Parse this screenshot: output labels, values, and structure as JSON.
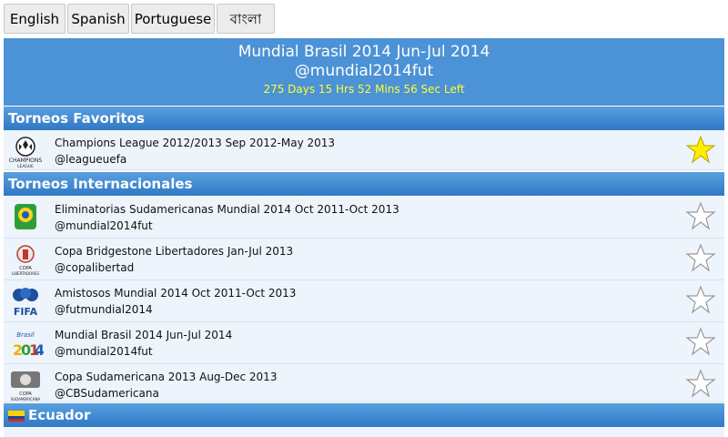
{
  "languages": [
    "English",
    "Spanish",
    "Portuguese",
    "বাংলা"
  ],
  "header": {
    "title": "Mundial Brasil 2014 Jun-Jul 2014",
    "handle": "@mundial2014fut",
    "countdown": "275 Days 15 Hrs 52 Mins 56 Sec Left"
  },
  "sections": {
    "favoritos": "Torneos Favoritos",
    "internacionales": "Torneos Internacionales",
    "ecuador": "Ecuador"
  },
  "favoritos": [
    {
      "name": "Champions League 2012/2013 Sep 2012-May 2013",
      "handle": "@leagueuefa",
      "logo": "champions-league-logo",
      "starred": true
    }
  ],
  "internacionales": [
    {
      "name": "Eliminatorias Sudamericanas Mundial 2014 Oct 2011-Oct 2013",
      "handle": "@mundial2014fut",
      "logo": "eliminatorias-logo",
      "starred": false
    },
    {
      "name": "Copa Bridgestone Libertadores Jan-Jul 2013",
      "handle": "@copalibertad",
      "logo": "libertadores-logo",
      "starred": false
    },
    {
      "name": "Amistosos Mundial 2014 Oct 2011-Oct 2013",
      "handle": "@futmundial2014",
      "logo": "fifa-logo",
      "starred": false
    },
    {
      "name": "Mundial Brasil 2014 Jun-Jul 2014",
      "handle": "@mundial2014fut",
      "logo": "brasil-2014-logo",
      "starred": false
    },
    {
      "name": "Copa Sudamericana 2013 Aug-Dec 2013",
      "handle": "@CBSudamericana",
      "logo": "sudamericana-logo",
      "starred": false
    }
  ],
  "colors": {
    "header_bg": "#4b92d6",
    "countdown": "#ffff33",
    "star_filled": "#ffee00",
    "row_bg": "#eef4fb"
  }
}
